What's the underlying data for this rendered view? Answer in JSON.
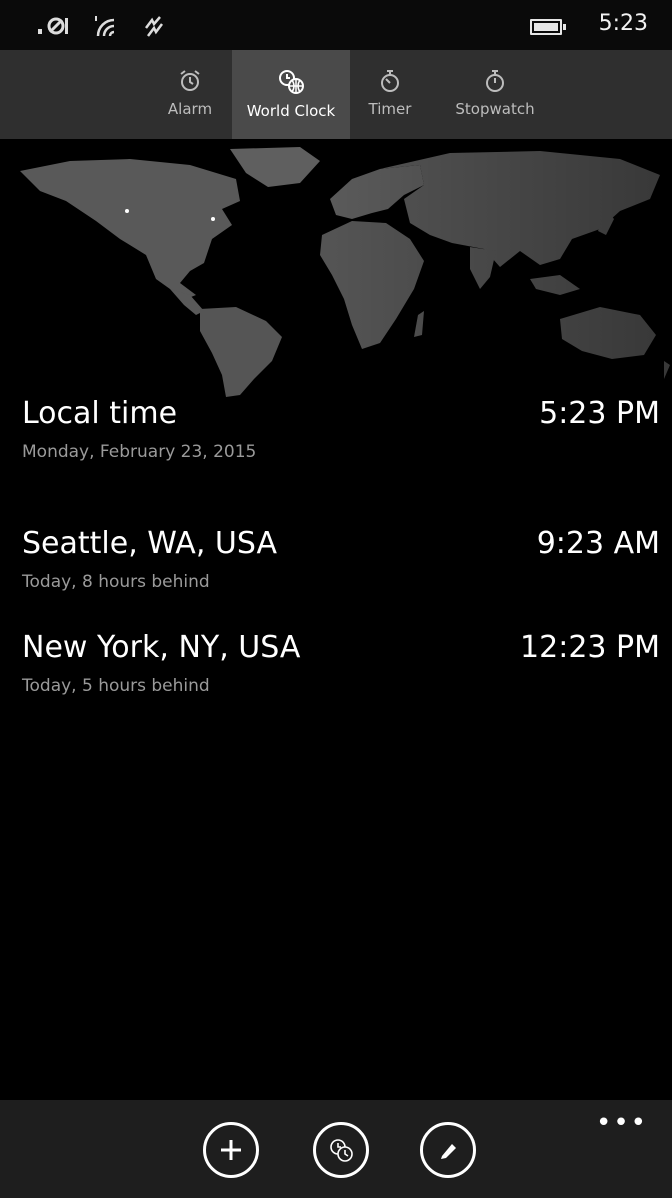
{
  "status_bar": {
    "time": "5:23",
    "icons": [
      "no-sim-icon",
      "wifi-icon",
      "data-sense-icon",
      "battery-icon"
    ]
  },
  "tabs": [
    {
      "label": "Alarm",
      "icon": "alarm-clock-icon",
      "active": false
    },
    {
      "label": "World Clock",
      "icon": "world-clock-icon",
      "active": true
    },
    {
      "label": "Timer",
      "icon": "timer-icon",
      "active": false
    },
    {
      "label": "Stopwatch",
      "icon": "stopwatch-icon",
      "active": false
    }
  ],
  "clocks": [
    {
      "city": "Local time",
      "time": "5:23 PM",
      "detail": "Monday, February 23, 2015"
    },
    {
      "city": "Seattle, WA, USA",
      "time": "9:23 AM",
      "detail": "Today, 8 hours behind"
    },
    {
      "city": "New York, NY, USA",
      "time": "12:23 PM",
      "detail": "Today, 5 hours behind"
    }
  ],
  "app_bar": {
    "buttons": [
      "add-icon",
      "compare-clocks-icon",
      "edit-icon"
    ],
    "more_label": "•••"
  },
  "colors": {
    "background": "#000000",
    "tab_bar": "#2f2f2f",
    "tab_active": "#4a4a4a",
    "app_bar": "#1e1e1e",
    "map_land": "#5a5a5a",
    "subtext": "#9a9a9a"
  }
}
